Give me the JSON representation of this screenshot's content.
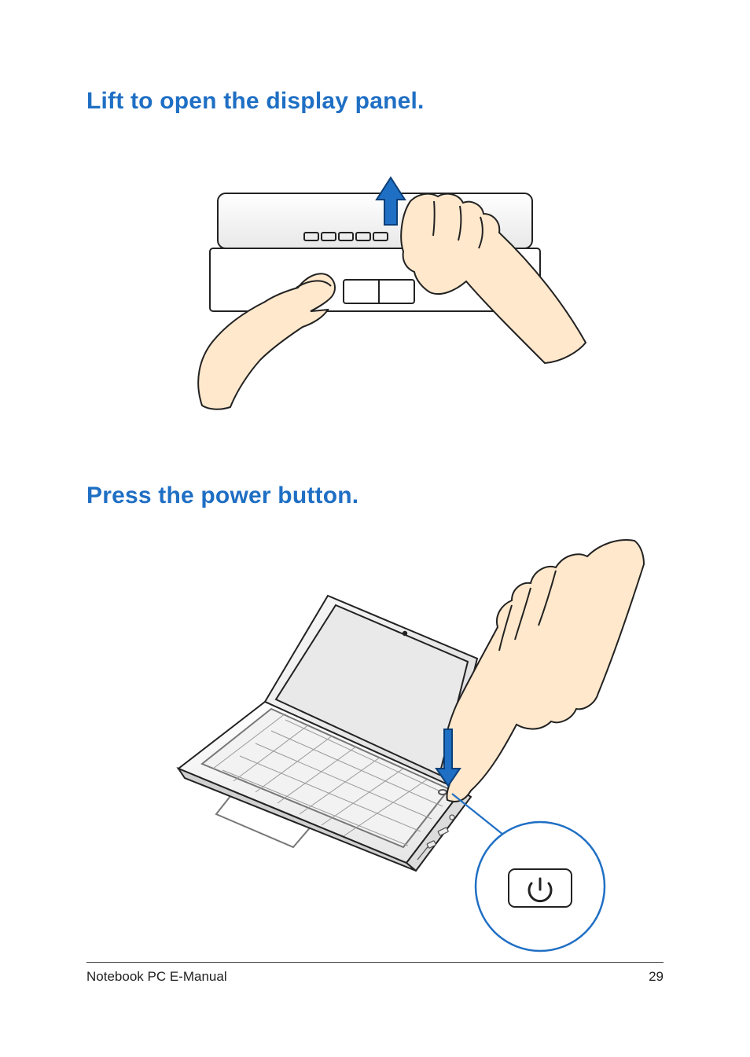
{
  "headings": {
    "lift": "Lift to open the display panel.",
    "press": "Press the power button."
  },
  "footer": {
    "title": "Notebook PC E-Manual",
    "page_number": "29"
  },
  "illustrations": {
    "lift_panel": {
      "description": "Two hands opening a laptop lid; an upward blue arrow indicates lifting the display panel.",
      "arrow_color": "#1f6fc4",
      "skin_tone": "#FFE8CC"
    },
    "press_power": {
      "description": "A hand pressing the power button on an open laptop; a downward blue arrow and a callout circle with the power icon.",
      "arrow_color": "#1f6fc4",
      "callout_stroke": "#1f6fc4",
      "power_icon": "power-icon"
    }
  }
}
